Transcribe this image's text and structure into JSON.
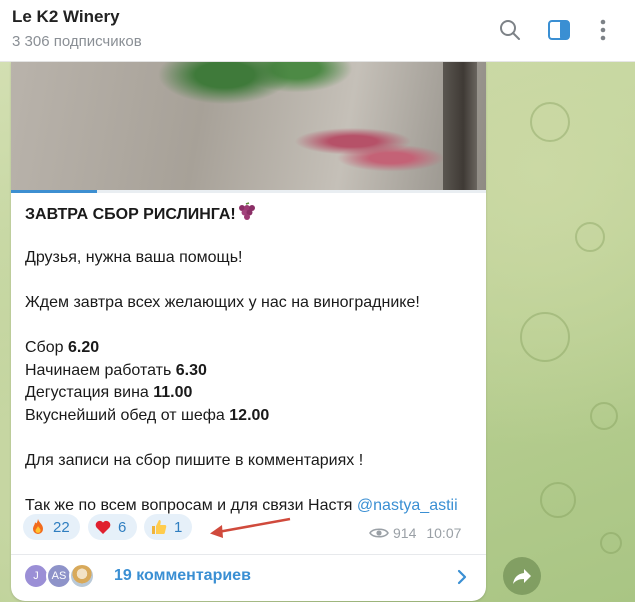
{
  "header": {
    "title": "Le K2 Winery",
    "subscribers": "3 306 подписчиков"
  },
  "post": {
    "media_progress": 0.18,
    "title": "ЗАВТРА СБОР РИСЛИНГА!",
    "title_emoji": "grapes-emoji",
    "lines": {
      "l1": "Друзья, нужна ваша помощь!",
      "l2": "Ждем завтра всех желающих у нас на винограднике!",
      "sbor_label": "Сбор ",
      "sbor_time": "6.20",
      "start_label": "Начинаем работать ",
      "start_time": "6.30",
      "tasting_label": "Дегустация вина ",
      "tasting_time": "11.00",
      "lunch_label": "Вкуснейший обед от шефа ",
      "lunch_time": "12.00",
      "l3": "Для записи на сбор пишите в комментариях !",
      "l4_prefix": "Так же по всем вопросам и для связи Настя ",
      "mention": "@nastya_astii"
    },
    "reactions": [
      {
        "icon": "fire-emoji",
        "count": "22"
      },
      {
        "icon": "heart-emoji",
        "count": "6"
      },
      {
        "icon": "thumbs-up-emoji",
        "count": "1"
      }
    ],
    "views": "914",
    "time": "10:07",
    "comments": {
      "avatars": [
        "J",
        "AS"
      ],
      "label": "19 комментариев"
    }
  },
  "colors": {
    "accent": "#3a8fd3",
    "annotation_arrow": "#d04a3c"
  }
}
